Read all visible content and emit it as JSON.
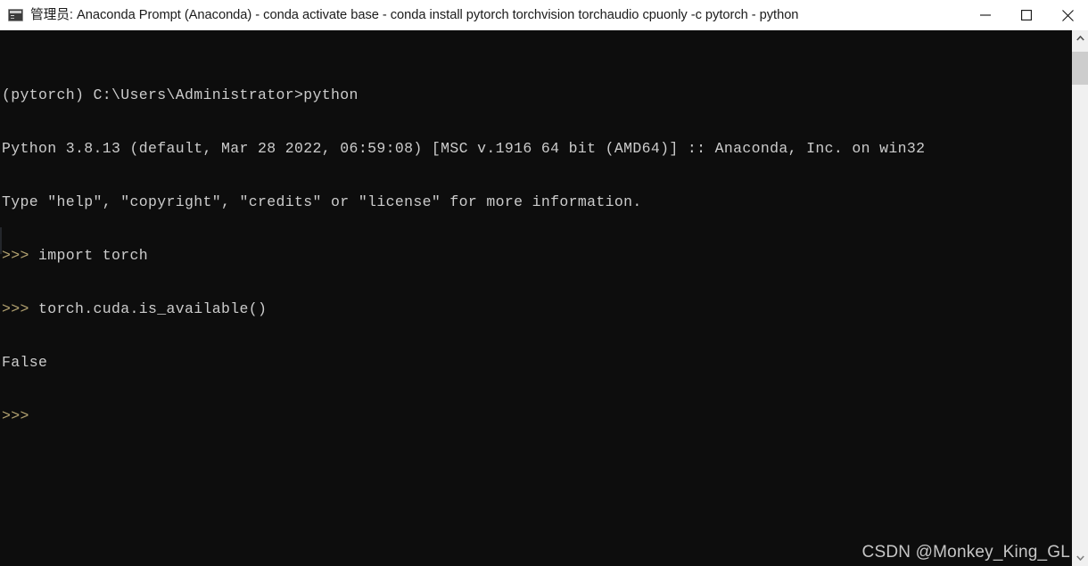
{
  "window": {
    "title": "管理员: Anaconda Prompt (Anaconda) - conda  activate base - conda  install pytorch torchvision torchaudio cpuonly -c pytorch - python",
    "icon": "console-icon",
    "controls": {
      "minimize_label": "—",
      "maximize_label": "□",
      "close_label": "✕"
    },
    "colors": {
      "titlebar_background": "#ffffff",
      "titlebar_text": "#1b1b1b",
      "terminal_background": "#0d0d0d",
      "terminal_text": "#cccccc",
      "prompt_text": "#b3a270",
      "scrollbar_track": "#f0f0f0",
      "scrollbar_thumb": "#cdcdcd"
    }
  },
  "terminal": {
    "lines": [
      {
        "prompt": "",
        "text": "(pytorch) C:\\Users\\Administrator>python"
      },
      {
        "prompt": "",
        "text": "Python 3.8.13 (default, Mar 28 2022, 06:59:08) [MSC v.1916 64 bit (AMD64)] :: Anaconda, Inc. on win32"
      },
      {
        "prompt": "",
        "text": "Type \"help\", \"copyright\", \"credits\" or \"license\" for more information."
      },
      {
        "prompt": ">>> ",
        "text": "import torch"
      },
      {
        "prompt": ">>> ",
        "text": "torch.cuda.is_available()"
      },
      {
        "prompt": "",
        "text": "False"
      },
      {
        "prompt": ">>>",
        "text": ""
      }
    ]
  },
  "watermark": {
    "text": "CSDN @Monkey_King_GL"
  },
  "scrollbar": {
    "up_arrow": "chevron-up-icon",
    "down_arrow": "chevron-down-icon"
  }
}
